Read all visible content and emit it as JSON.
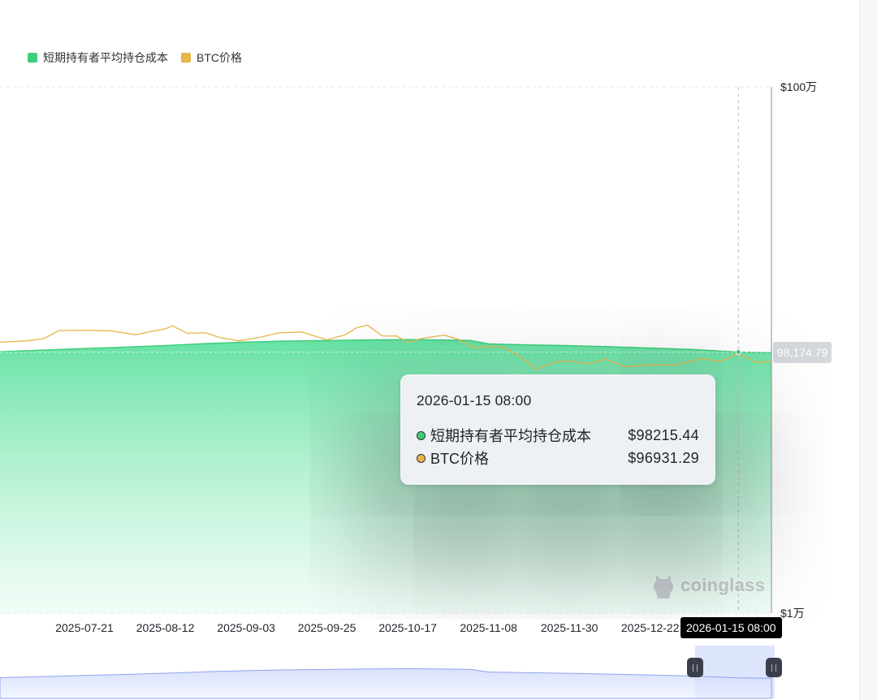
{
  "legend": [
    {
      "label": "短期持有者平均持仓成本",
      "color": "#3ecf7a"
    },
    {
      "label": "BTC价格",
      "color": "#e8b64a"
    }
  ],
  "tooltip": {
    "title": "2026-01-15 08:00",
    "rows": [
      {
        "name": "短期持有者平均持仓成本",
        "value": "$98215.44",
        "dot_color": "#3ecf7a"
      },
      {
        "name": "BTC价格",
        "value": "$96931.29",
        "dot_color": "#e8b64a"
      }
    ]
  },
  "crosshair_date_label": "2026-01-15 08:00",
  "current_price_label": "98,174.79",
  "watermark": "coinglass",
  "chart_data": {
    "type": "area",
    "y_scale": "log",
    "ylim": [
      10000,
      1000000
    ],
    "y_tick_labels": [
      "$100万",
      "$1万"
    ],
    "x_tick_labels": [
      "2025-07-21",
      "2025-08-12",
      "2025-09-03",
      "2025-09-25",
      "2025-10-17",
      "2025-11-08",
      "2025-11-30",
      "2025-12-22"
    ],
    "x_range": [
      "2025-06-28",
      "2026-01-24"
    ],
    "grid": true,
    "legend_position": "top-left",
    "series": [
      {
        "name": "短期持有者平均持仓成本",
        "type": "area",
        "color": "#3ecf7a",
        "x": [
          "2025-06-28",
          "2025-07-10",
          "2025-07-21",
          "2025-08-01",
          "2025-08-12",
          "2025-08-23",
          "2025-09-03",
          "2025-09-14",
          "2025-09-25",
          "2025-10-06",
          "2025-10-17",
          "2025-10-28",
          "2025-11-03",
          "2025-11-08",
          "2025-11-19",
          "2025-11-30",
          "2025-12-11",
          "2025-12-22",
          "2026-01-02",
          "2026-01-15",
          "2026-01-24"
        ],
        "y": [
          98500,
          99900,
          101200,
          102500,
          104000,
          105800,
          107100,
          108100,
          108600,
          109200,
          109500,
          109100,
          108700,
          105500,
          104600,
          103900,
          102900,
          101700,
          100600,
          98200,
          97700
        ]
      },
      {
        "name": "BTC价格",
        "type": "line",
        "color": "#e8b64a",
        "x": [
          "2025-06-28",
          "2025-07-05",
          "2025-07-10",
          "2025-07-14",
          "2025-07-21",
          "2025-07-28",
          "2025-08-04",
          "2025-08-08",
          "2025-08-12",
          "2025-08-14",
          "2025-08-18",
          "2025-08-23",
          "2025-08-27",
          "2025-09-01",
          "2025-09-06",
          "2025-09-12",
          "2025-09-18",
          "2025-09-22",
          "2025-09-25",
          "2025-09-30",
          "2025-10-03",
          "2025-10-06",
          "2025-10-10",
          "2025-10-14",
          "2025-10-17",
          "2025-10-21",
          "2025-10-27",
          "2025-10-31",
          "2025-11-04",
          "2025-11-08",
          "2025-11-12",
          "2025-11-16",
          "2025-11-21",
          "2025-11-26",
          "2025-11-30",
          "2025-12-05",
          "2025-12-10",
          "2025-12-15",
          "2025-12-22",
          "2025-12-29",
          "2026-01-05",
          "2026-01-10",
          "2026-01-15",
          "2026-01-20",
          "2026-01-24"
        ],
        "y": [
          107000,
          108300,
          110500,
          118500,
          118900,
          118300,
          114300,
          117500,
          120400,
          123500,
          115800,
          116300,
          111300,
          108400,
          111200,
          116200,
          117100,
          112700,
          109300,
          114300,
          121200,
          124500,
          113200,
          113000,
          106900,
          110800,
          114000,
          109400,
          101800,
          103200,
          102500,
          95400,
          84500,
          89900,
          90800,
          88600,
          92300,
          86400,
          87800,
          87800,
          92600,
          90500,
          96900,
          89700,
          90500
        ]
      }
    ]
  }
}
